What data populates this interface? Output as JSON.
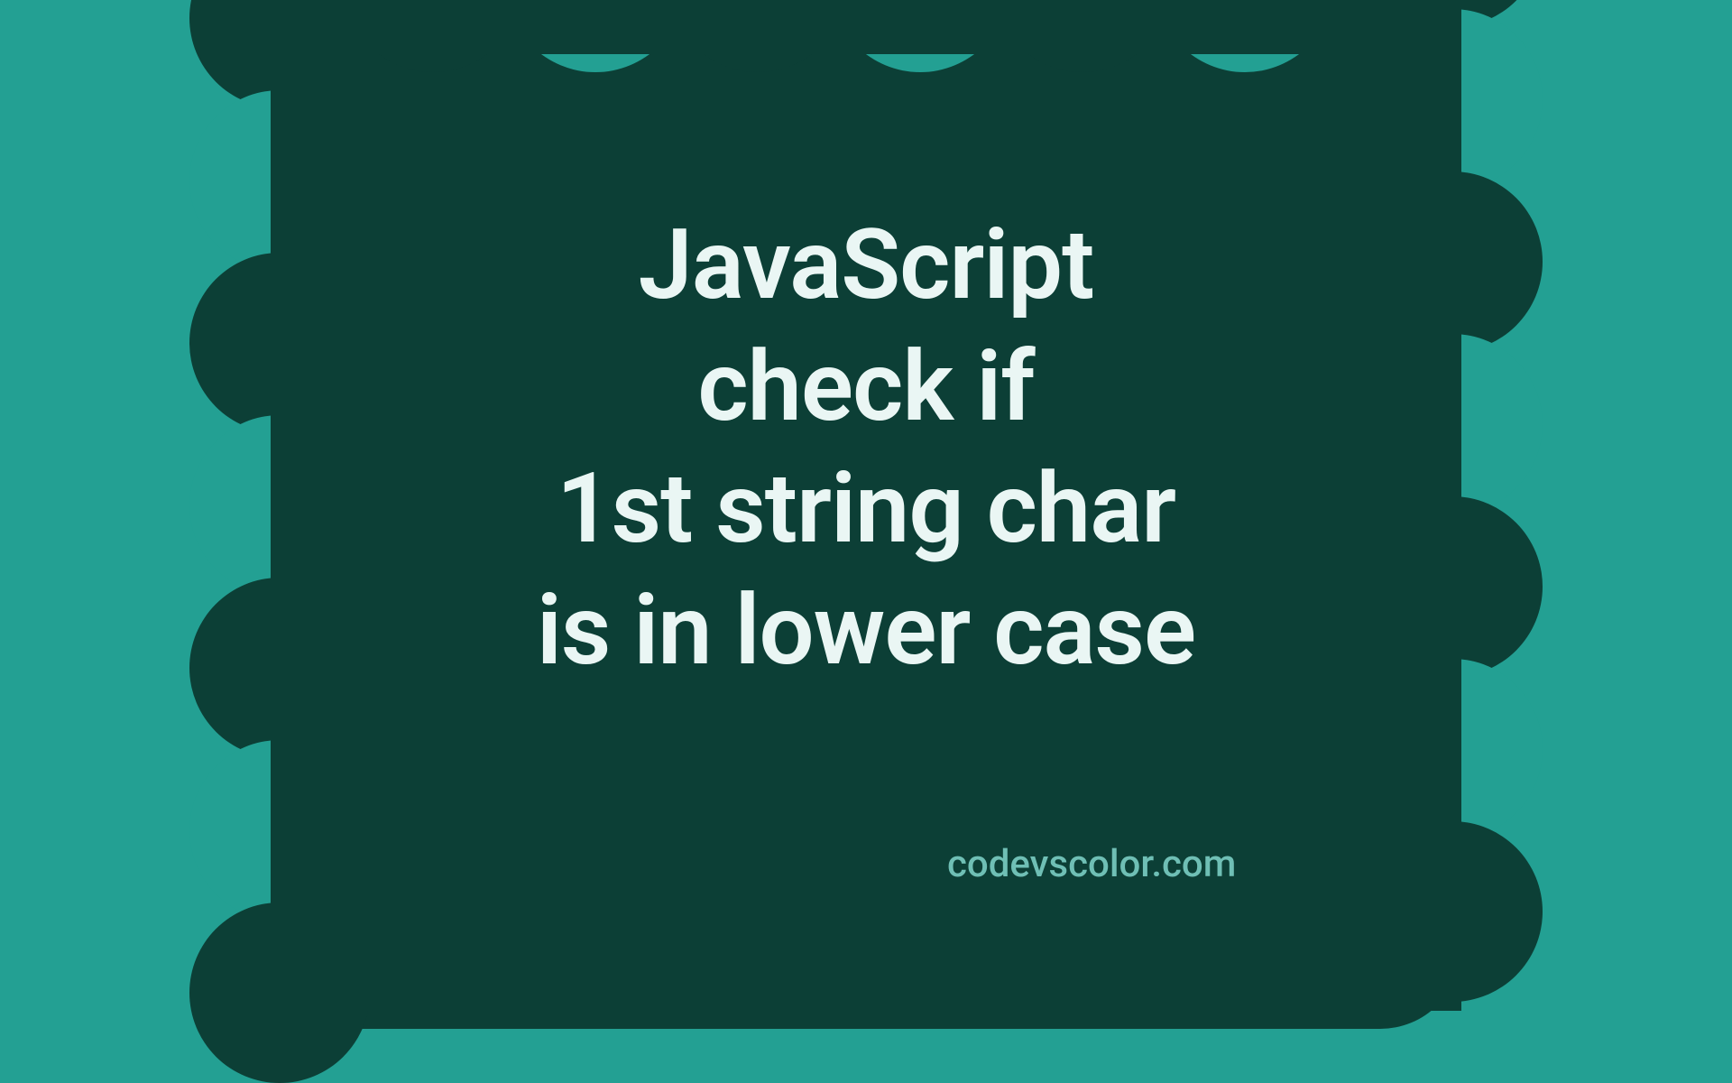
{
  "title": {
    "line1": "JavaScript",
    "line2": "check if",
    "line3": "1st string char",
    "line4": "is in lower case"
  },
  "watermark": "codevscolor.com",
  "colors": {
    "bg_light": "#23a093",
    "bg_dark": "#0c3f36",
    "text": "#eaf6f4",
    "watermark": "#6fbfb5"
  }
}
